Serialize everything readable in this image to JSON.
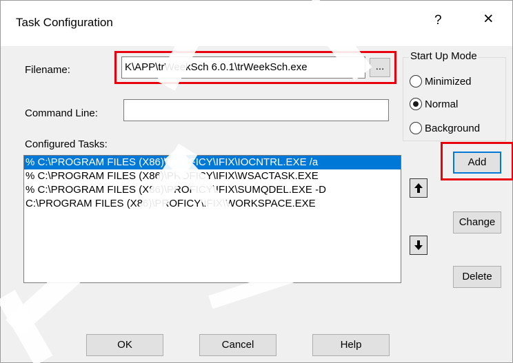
{
  "window": {
    "title": "Task Configuration",
    "help_glyph": "?",
    "close_glyph": "×"
  },
  "filename": {
    "label": "Filename:",
    "value": "K\\APP\\trWeekSch 6.0.1\\trWeekSch.exe",
    "browse_label": "..."
  },
  "command_line": {
    "label": "Command Line:",
    "value": ""
  },
  "startup_mode": {
    "legend": "Start Up Mode",
    "options": [
      {
        "label": "Minimized",
        "selected": false
      },
      {
        "label": "Normal",
        "selected": true
      },
      {
        "label": "Background",
        "selected": false
      }
    ]
  },
  "configured_tasks": {
    "label": "Configured Tasks:",
    "items": [
      {
        "text": "% C:\\PROGRAM FILES (X86)\\PROFICY\\IFIX\\IOCNTRL.EXE  /a",
        "selected": true
      },
      {
        "text": "% C:\\PROGRAM FILES (X86)\\PROFICY\\IFIX\\WSACTASK.EXE",
        "selected": false
      },
      {
        "text": "% C:\\PROGRAM FILES (X86)\\PROFICY\\IFIX\\SUMQDEL.EXE  -D",
        "selected": false
      },
      {
        "text": "  C:\\PROGRAM FILES (X86)\\PROFICY\\IFIX\\WORKSPACE.EXE",
        "selected": false
      }
    ]
  },
  "side_buttons": {
    "add": "Add",
    "change": "Change",
    "delete": "Delete",
    "move_up_icon": "arrow-up-icon",
    "move_down_icon": "arrow-down-icon"
  },
  "footer": {
    "ok": "OK",
    "cancel": "Cancel",
    "help": "Help"
  },
  "colors": {
    "highlight_box": "#e8000d",
    "selection": "#0078d7",
    "dialog_background": "#f0f0f0"
  }
}
